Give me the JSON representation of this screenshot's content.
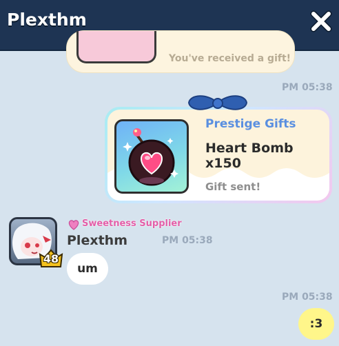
{
  "header": {
    "title": "Plexthm",
    "close_icon": "close-icon"
  },
  "previous_message": {
    "text": "You've received a gift!"
  },
  "gift_message": {
    "time": "PM 05:38",
    "category": "Prestige Gifts",
    "item": "Heart Bomb x150",
    "status": "Gift sent!",
    "icon": "heart-bomb-icon"
  },
  "incoming_message": {
    "sender_title": "Sweetness Supplier",
    "sender_name": "Plexthm",
    "level": "48",
    "time": "PM 05:38",
    "text": "um"
  },
  "outgoing_message": {
    "time": "PM 05:38",
    "text": ":3"
  },
  "colors": {
    "header": "#1e3453",
    "background": "#d6e3ee",
    "gift_category": "#5a8fe0",
    "title_pink": "#e35ea8",
    "outgoing_bubble": "#fff68a",
    "bow": "#2f5fb0"
  }
}
